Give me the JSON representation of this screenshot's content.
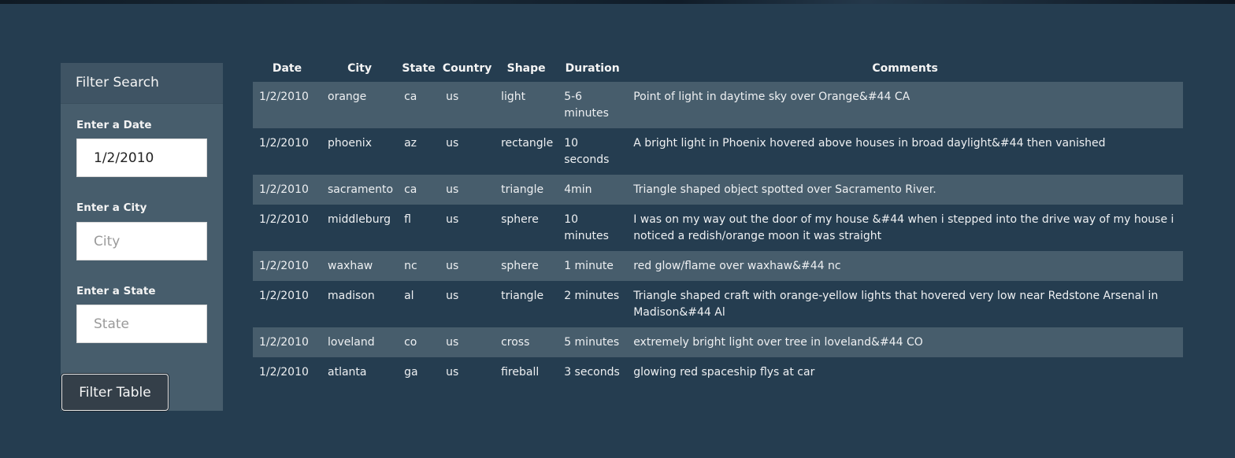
{
  "filter_panel": {
    "title": "Filter Search",
    "date": {
      "label": "Enter a Date",
      "value": "1/2/2010",
      "placeholder": ""
    },
    "city": {
      "label": "Enter a City",
      "value": "",
      "placeholder": "City"
    },
    "state": {
      "label": "Enter a State",
      "value": "",
      "placeholder": "State"
    },
    "button_label": "Filter Table"
  },
  "table": {
    "headers": {
      "date": "Date",
      "city": "City",
      "state": "State",
      "country": "Country",
      "shape": "Shape",
      "duration": "Duration",
      "comments": "Comments"
    },
    "rows": [
      {
        "date": "1/2/2010",
        "city": "orange",
        "state": "ca",
        "country": "us",
        "shape": "light",
        "duration": "5-6 minutes",
        "comments": "Point of light in daytime sky over Orange&#44 CA"
      },
      {
        "date": "1/2/2010",
        "city": "phoenix",
        "state": "az",
        "country": "us",
        "shape": "rectangle",
        "duration": "10 seconds",
        "comments": "A bright light in Phoenix hovered above houses in broad daylight&#44 then vanished"
      },
      {
        "date": "1/2/2010",
        "city": "sacramento",
        "state": "ca",
        "country": "us",
        "shape": "triangle",
        "duration": "4min",
        "comments": "Triangle shaped object spotted over Sacramento River."
      },
      {
        "date": "1/2/2010",
        "city": "middleburg",
        "state": "fl",
        "country": "us",
        "shape": "sphere",
        "duration": "10 minutes",
        "comments": "I was on my way out the door of my house &#44 when i stepped into the drive way of my house i noticed a redish/orange moon it was straight"
      },
      {
        "date": "1/2/2010",
        "city": "waxhaw",
        "state": "nc",
        "country": "us",
        "shape": "sphere",
        "duration": "1 minute",
        "comments": "red glow/flame over waxhaw&#44 nc"
      },
      {
        "date": "1/2/2010",
        "city": "madison",
        "state": "al",
        "country": "us",
        "shape": "triangle",
        "duration": "2 minutes",
        "comments": "Triangle shaped craft with orange-yellow lights that hovered very low near Redstone Arsenal in Madison&#44 Al"
      },
      {
        "date": "1/2/2010",
        "city": "loveland",
        "state": "co",
        "country": "us",
        "shape": "cross",
        "duration": "5 minutes",
        "comments": "extremely bright light over tree in loveland&#44 CO"
      },
      {
        "date": "1/2/2010",
        "city": "atlanta",
        "state": "ga",
        "country": "us",
        "shape": "fireball",
        "duration": "3 seconds",
        "comments": "glowing red spaceship flys at car"
      }
    ]
  }
}
